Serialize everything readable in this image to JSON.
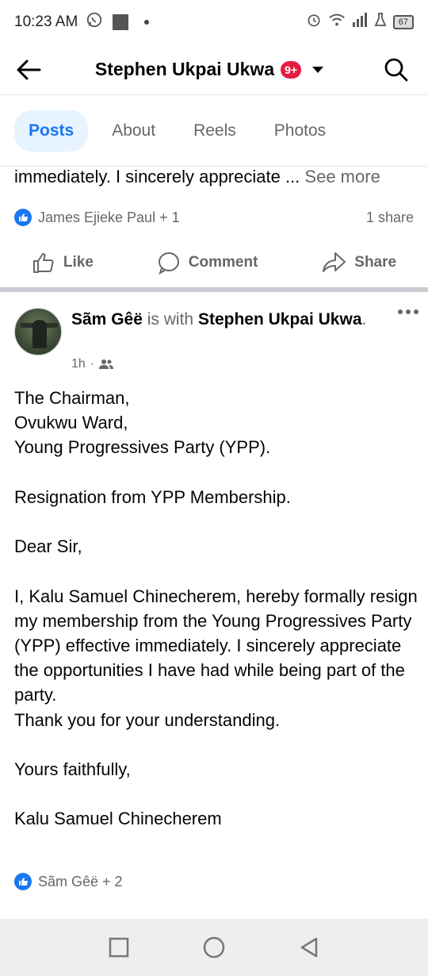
{
  "status_bar": {
    "time": "10:23 AM",
    "battery": "67"
  },
  "header": {
    "title": "Stephen Ukpai Ukwa",
    "badge": "9+"
  },
  "tabs": [
    {
      "label": "Posts",
      "active": true
    },
    {
      "label": "About",
      "active": false
    },
    {
      "label": "Reels",
      "active": false
    },
    {
      "label": "Photos",
      "active": false
    }
  ],
  "prev_post": {
    "snippet": "immediately. I sincerely appreciate ...",
    "see_more": "See more",
    "reactions": "James Ejieke Paul + 1",
    "shares": "1 share",
    "actions": {
      "like": "Like",
      "comment": "Comment",
      "share": "Share"
    }
  },
  "post": {
    "author": "Sãm Gêë",
    "with_text": "is with",
    "tagged": "Stephen Ukpai Ukwa",
    "period": ".",
    "time": "1h",
    "separator": "·",
    "body": [
      "The Chairman,",
      "Ovukwu Ward,",
      "Young Progressives Party (YPP).",
      "",
      "Resignation from YPP Membership.",
      "",
      "Dear Sir,",
      "",
      "I, Kalu Samuel Chinecherem, hereby formally resign my membership from the Young Progressives Party (YPP) effective immediately. I sincerely appreciate the opportunities I have had while being part of the party.",
      "Thank you for your understanding.",
      "",
      "Yours faithfully,",
      "",
      "Kalu Samuel Chinecherem"
    ],
    "reactions": "Sãm Gêë + 2"
  },
  "colors": {
    "accent": "#1877f2",
    "muted": "#65676b",
    "badge": "#e41e3f"
  }
}
